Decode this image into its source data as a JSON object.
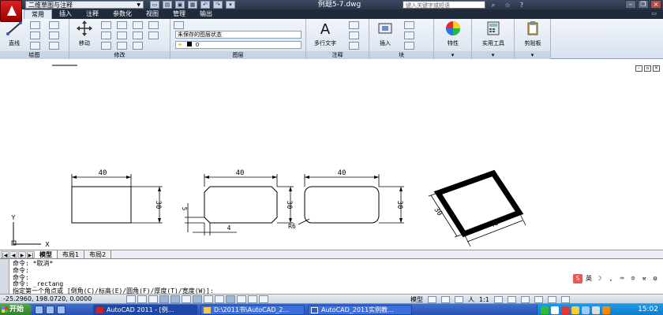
{
  "titlebar": {
    "workspace": "二维草图与注释",
    "document_title": "例题5-7.dwg",
    "search_placeholder": "键入关键字或短语"
  },
  "ribbon": {
    "tabs": [
      "常用",
      "插入",
      "注释",
      "参数化",
      "视图",
      "管理",
      "输出"
    ],
    "active_tab": "常用",
    "draw_panel": {
      "title": "绘图",
      "line_label": "直线"
    },
    "modify_panel": {
      "title": "修改",
      "move_label": "移动"
    },
    "layers_panel": {
      "title": "图层",
      "layer_state": "未保存的图层状态",
      "current_layer": "0"
    },
    "annotation_panel": {
      "title": "注释",
      "mtext_label": "多行文字"
    },
    "block_panel": {
      "title": "块",
      "insert_label": "插入"
    },
    "properties_label": "特性",
    "utilities_label": "实用工具",
    "clipboard_label": "剪贴板"
  },
  "drawing": {
    "shape1": {
      "width_dim": "40",
      "height_dim": "30"
    },
    "shape2": {
      "width_dim": "40",
      "height_dim": "30",
      "chamfer_v": "5",
      "chamfer_h": "4"
    },
    "shape3": {
      "width_dim": "40",
      "height_dim": "30",
      "radius_label": "R6"
    },
    "shape4": {
      "width_dim": "40",
      "height_dim": "30"
    },
    "ucs": {
      "x_label": "X",
      "y_label": "Y"
    }
  },
  "layout_tabs": [
    "模型",
    "布局1",
    "布局2"
  ],
  "active_layout": "模型",
  "command": {
    "lines": [
      "命令: *取消*",
      "命令:",
      "命令:",
      "命令: _rectang",
      "指定第一个角点或 [倒角(C)/标高(E)/圆角(F)/厚度(T)/宽度(W)]:"
    ]
  },
  "status": {
    "coordinates": "-25.2960, 198.0720, 0.0000",
    "model_label": "模型",
    "annotation_scale": "1:1"
  },
  "taskbar": {
    "start_label": "开始",
    "tasks": [
      "AutoCAD 2011 - [例...",
      "D:\\2011书\\AutoCAD_2...",
      "AutoCAD_2011实例教..."
    ],
    "clock": "15:02"
  },
  "colors": {
    "ribbon_bg": "#dfe8f3",
    "titlebar_bg": "#2a3548",
    "taskbar_bg": "#2a52b0",
    "start_green": "#2f7c2b"
  }
}
